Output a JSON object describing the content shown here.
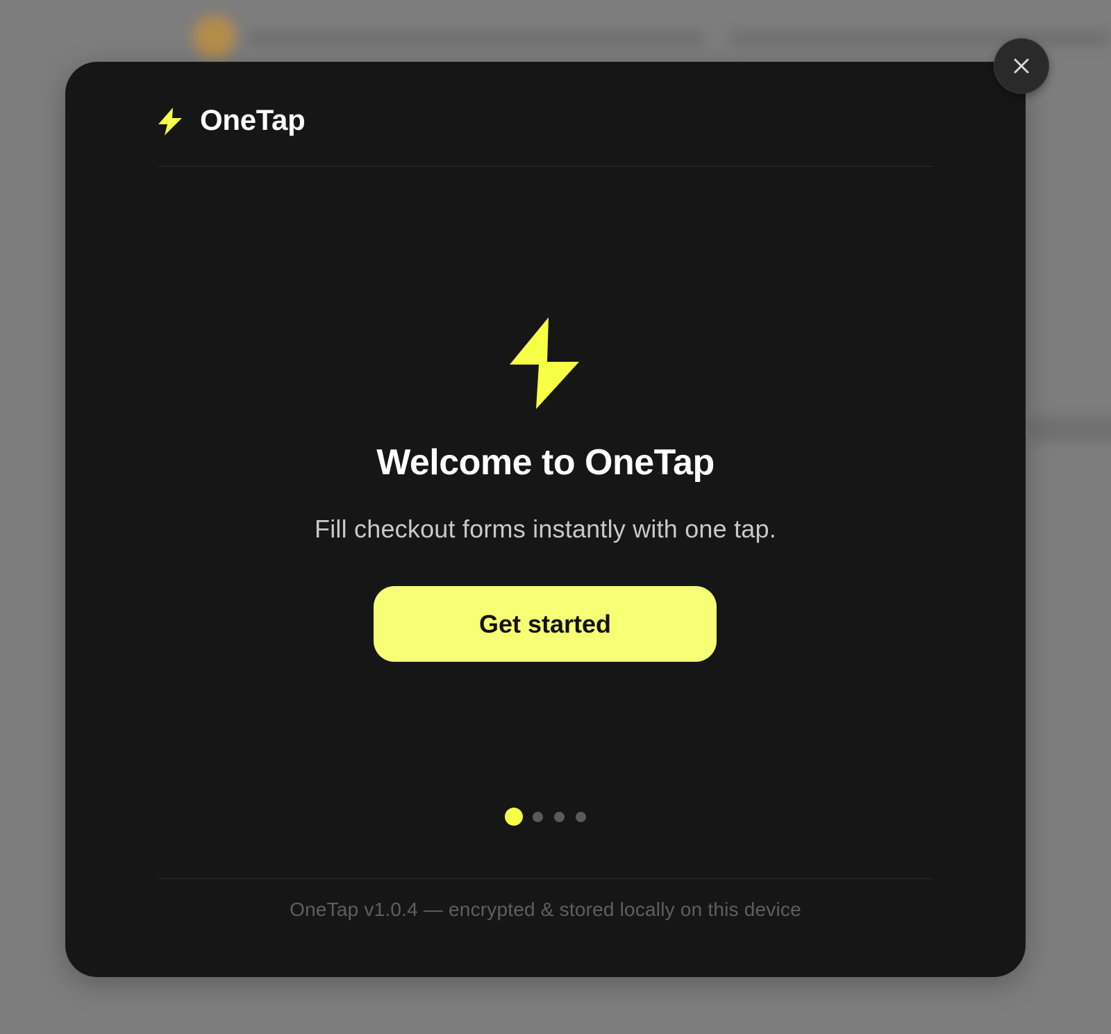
{
  "app": {
    "name": "OneTap",
    "logo_icon": "lightning-bolt-icon",
    "accent_color": "#f7ff46"
  },
  "onboarding": {
    "title": "Welcome to OneTap",
    "subtitle": "Fill checkout forms instantly with one tap.",
    "cta_label": "Get started",
    "hero_icon": "lightning-bolt-icon",
    "pager": {
      "total_steps": 4,
      "current_step": 1
    }
  },
  "footer": {
    "text": "OneTap v1.0.4 — encrypted & stored locally on this device"
  },
  "close_button": {
    "icon": "close-icon"
  },
  "colors": {
    "modal_background": "#161616",
    "overlay": "#7d7d7d",
    "cta_background": "#f7ff74",
    "cta_text": "#111111",
    "inactive_dot": "#5a5a5a"
  }
}
